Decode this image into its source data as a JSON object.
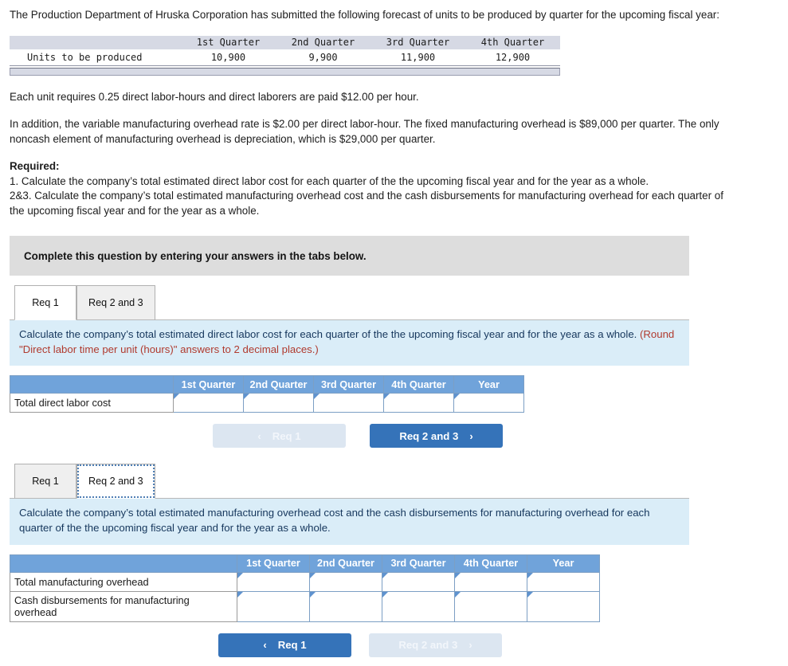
{
  "intro": {
    "paragraph": "The Production Department of Hruska Corporation has submitted the following forecast of units to be produced by quarter for the upcoming fiscal year:"
  },
  "forecast_table": {
    "headers": [
      "",
      "1st Quarter",
      "2nd Quarter",
      "3rd Quarter",
      "4th Quarter"
    ],
    "row_label": "Units to be produced",
    "values": [
      "10,900",
      "9,900",
      "11,900",
      "12,900"
    ]
  },
  "facts": {
    "labor": "Each unit requires 0.25 direct labor-hours and direct laborers are paid $12.00 per hour.",
    "overhead": "In addition, the variable manufacturing overhead rate is $2.00 per direct labor-hour. The fixed manufacturing overhead is $89,000 per quarter. The only noncash element of manufacturing overhead is depreciation, which is $29,000 per quarter."
  },
  "required": {
    "title": "Required:",
    "item1": "1. Calculate the company’s total estimated direct labor cost for each quarter of the the upcoming fiscal year and for the year as a whole.",
    "item2": "2&3. Calculate the company’s total estimated manufacturing overhead cost and the cash disbursements for manufacturing overhead for each quarter of the upcoming fiscal year and for the year as a whole."
  },
  "banner": {
    "text": "Complete this question by entering your answers in the tabs below."
  },
  "tabs_top": {
    "items": [
      {
        "label": "Req 1",
        "state": "active"
      },
      {
        "label": "Req 2 and 3",
        "state": "inactive"
      }
    ]
  },
  "panel1": {
    "instruction": "Calculate the company’s total estimated direct labor cost for each quarter of the the upcoming fiscal year and for the year as",
    "instruction2": "a whole.",
    "hint": "(Round \"Direct labor time per unit (hours)\" answers to 2 decimal places.)",
    "table": {
      "headers": [
        "",
        "1st Quarter",
        "2nd Quarter",
        "3rd Quarter",
        "4th Quarter",
        "Year"
      ],
      "rows": [
        {
          "label": "Total direct labor cost",
          "values": [
            "",
            "",
            "",
            "",
            ""
          ]
        }
      ]
    },
    "nav": {
      "prev_label": "Req 1",
      "prev_state": "disabled",
      "prev_icon": "chevron-left-icon",
      "next_label": "Req 2 and 3",
      "next_state": "primary",
      "next_icon": "chevron-right-icon"
    }
  },
  "tabs_bottom": {
    "items": [
      {
        "label": "Req 1",
        "state": "inactive"
      },
      {
        "label": "Req 2 and 3",
        "state": "active"
      }
    ]
  },
  "panel2": {
    "instruction": "Calculate the company’s total estimated manufacturing overhead cost and the cash disbursements for manufacturing overhead for",
    "instruction2": "each quarter of the the upcoming fiscal year and for the year as a whole.",
    "table": {
      "headers": [
        "",
        "1st Quarter",
        "2nd Quarter",
        "3rd Quarter",
        "4th Quarter",
        "Year"
      ],
      "rows": [
        {
          "label": "Total manufacturing overhead",
          "values": [
            "",
            "",
            "",
            "",
            ""
          ]
        },
        {
          "label": "Cash disbursements for manufacturing overhead",
          "values": [
            "",
            "",
            "",
            "",
            ""
          ]
        }
      ]
    },
    "nav": {
      "prev_label": "Req 1",
      "prev_state": "primary",
      "prev_icon": "chevron-left-icon",
      "next_label": "Req 2 and 3",
      "next_state": "disabled",
      "next_icon": "chevron-right-icon"
    }
  },
  "colors": {
    "table_header_blue": "#70a3da",
    "info_bar_blue": "#daedf8",
    "banner_grey": "#dddddd",
    "primary_button": "#3573b9",
    "disabled_button": "#dce6f1",
    "hint_red": "#b03a2e"
  },
  "icons": {
    "chevron_left": "‹",
    "chevron_right": "›"
  }
}
